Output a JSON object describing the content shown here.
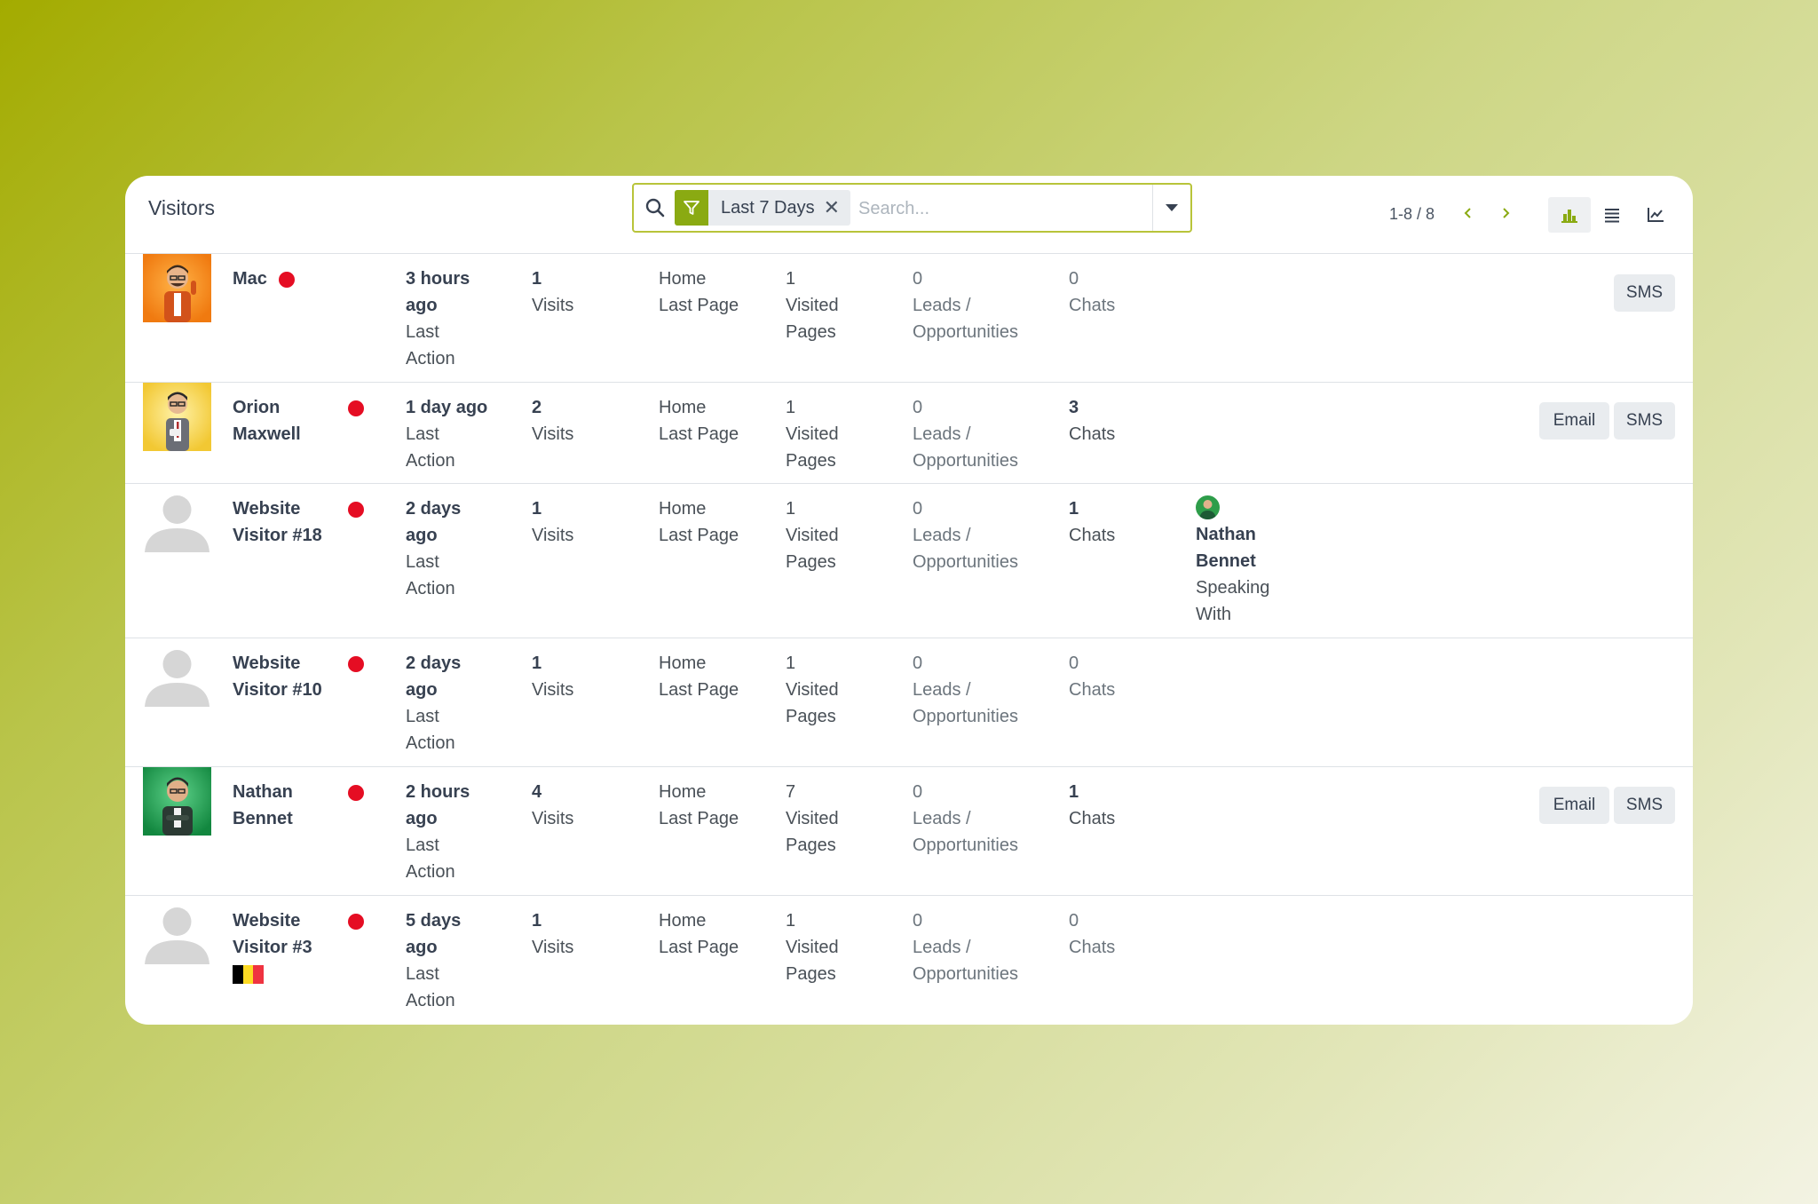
{
  "header": {
    "title": "Visitors",
    "search": {
      "facet_label": "Last 7 Days",
      "facet_close": "✕",
      "placeholder": "Search..."
    },
    "pager": {
      "value": "1-8 / 8"
    },
    "icons": [
      "search-icon",
      "filter-icon",
      "close-icon",
      "caret-down-icon",
      "chevron-left-icon",
      "chevron-right-icon",
      "bar-chart-icon",
      "list-icon",
      "line-chart-icon"
    ],
    "colors": {
      "accent": "#8aaa12",
      "status_dot": "#e50d23"
    }
  },
  "rows": [
    {
      "name_line1": "Mac",
      "name_line2": "",
      "avatar": "cartoon-man-orange",
      "last_action_value": [
        "3 hours",
        "ago"
      ],
      "last_action_label": [
        "Last",
        "Action"
      ],
      "visits_value": "1",
      "visits_label": "Visits",
      "last_page_value": "Home",
      "last_page_label": "Last Page",
      "visited_value": "1",
      "visited_label": [
        "Visited",
        "Pages"
      ],
      "leads_value": "0",
      "leads_label": [
        "Leads /",
        "Opportunities"
      ],
      "chats_value": "0",
      "chats_label": "Chats",
      "buttons": [
        "SMS"
      ]
    },
    {
      "name_line1": "Orion",
      "name_line2": "Maxwell",
      "avatar": "cartoon-man-yellow",
      "last_action_value": [
        "1 day ago"
      ],
      "last_action_label": [
        "Last",
        "Action"
      ],
      "visits_value": "2",
      "visits_label": "Visits",
      "last_page_value": "Home",
      "last_page_label": "Last Page",
      "visited_value": "1",
      "visited_label": [
        "Visited",
        "Pages"
      ],
      "leads_value": "0",
      "leads_label": [
        "Leads /",
        "Opportunities"
      ],
      "chats_value": "3",
      "chats_label": "Chats",
      "buttons": [
        "Email",
        "SMS"
      ]
    },
    {
      "name_line1": "Website",
      "name_line2": "Visitor #18",
      "avatar": "placeholder-person",
      "last_action_value": [
        "2 days",
        "ago"
      ],
      "last_action_label": [
        "Last",
        "Action"
      ],
      "visits_value": "1",
      "visits_label": "Visits",
      "last_page_value": "Home",
      "last_page_label": "Last Page",
      "visited_value": "1",
      "visited_label": [
        "Visited",
        "Pages"
      ],
      "leads_value": "0",
      "leads_label": [
        "Leads /",
        "Opportunities"
      ],
      "chats_value": "1",
      "chats_label": "Chats",
      "speaking_with": {
        "name_line1": "Nathan",
        "name_line2": "Bennet",
        "label_line1": "Speaking",
        "label_line2": "With"
      },
      "buttons": []
    },
    {
      "name_line1": "Website",
      "name_line2": "Visitor #10",
      "avatar": "placeholder-person",
      "last_action_value": [
        "2 days",
        "ago"
      ],
      "last_action_label": [
        "Last",
        "Action"
      ],
      "visits_value": "1",
      "visits_label": "Visits",
      "last_page_value": "Home",
      "last_page_label": "Last Page",
      "visited_value": "1",
      "visited_label": [
        "Visited",
        "Pages"
      ],
      "leads_value": "0",
      "leads_label": [
        "Leads /",
        "Opportunities"
      ],
      "chats_value": "0",
      "chats_label": "Chats",
      "buttons": []
    },
    {
      "name_line1": "Nathan",
      "name_line2": "Bennet",
      "avatar": "cartoon-man-green",
      "last_action_value": [
        "2 hours",
        "ago"
      ],
      "last_action_label": [
        "Last",
        "Action"
      ],
      "visits_value": "4",
      "visits_label": "Visits",
      "last_page_value": "Home",
      "last_page_label": "Last Page",
      "visited_value": "7",
      "visited_label": [
        "Visited",
        "Pages"
      ],
      "leads_value": "0",
      "leads_label": [
        "Leads /",
        "Opportunities"
      ],
      "chats_value": "1",
      "chats_label": "Chats",
      "buttons": [
        "Email",
        "SMS"
      ]
    },
    {
      "name_line1": "Website",
      "name_line2": "Visitor #3",
      "avatar": "placeholder-person",
      "flag": "belgium-flag-icon",
      "last_action_value": [
        "5 days",
        "ago"
      ],
      "last_action_label": [
        "Last",
        "Action"
      ],
      "visits_value": "1",
      "visits_label": "Visits",
      "last_page_value": "Home",
      "last_page_label": "Last Page",
      "visited_value": "1",
      "visited_label": [
        "Visited",
        "Pages"
      ],
      "leads_value": "0",
      "leads_label": [
        "Leads /",
        "Opportunities"
      ],
      "chats_value": "0",
      "chats_label": "Chats",
      "buttons": []
    }
  ]
}
